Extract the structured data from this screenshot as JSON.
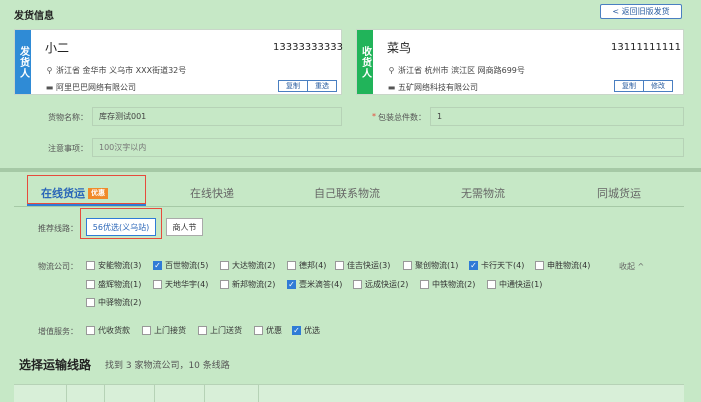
{
  "header": {
    "title": "发货信息",
    "back_label": "< 返回旧版发货"
  },
  "sender": {
    "tag": "发货人",
    "name": "小二",
    "phone": "13333333333",
    "address": "浙江省 金华市 义乌市 XXX街道32号",
    "company": "阿里巴巴网络有限公司",
    "btn_copy": "复制",
    "btn_reselect": "重选"
  },
  "receiver": {
    "tag": "收货人",
    "name": "菜鸟",
    "phone": "13111111111",
    "address": "浙江省 杭州市 滨江区 网商路699号",
    "company": "五矿网络科技有限公司",
    "btn_copy": "复制",
    "btn_edit": "修改"
  },
  "goods": {
    "name_label": "货物名称：",
    "name_value": "库存测试001",
    "pkg_label": "包装总件数：",
    "pkg_star": "*",
    "pkg_value": "1",
    "notes_label": "注意事项：",
    "notes_placeholder": "100汉字以内"
  },
  "tabs": [
    {
      "label": "在线货运",
      "badge": "优惠"
    },
    {
      "label": "在线快递"
    },
    {
      "label": "自己联系物流"
    },
    {
      "label": "无需物流"
    },
    {
      "label": "同城货运"
    }
  ],
  "routes": {
    "label": "推荐线路：",
    "selected": "56优选(义乌站)",
    "other": "商人节"
  },
  "logistics": {
    "label": "物流公司：",
    "collapse": "收起 ^",
    "row1": [
      {
        "text": "安能物流(3)",
        "checked": false
      },
      {
        "text": "百世物流(5)",
        "checked": true
      },
      {
        "text": "大达物流(2)",
        "checked": false
      },
      {
        "text": "德邦(4)",
        "checked": false
      },
      {
        "text": "佳吉快运(3)",
        "checked": false
      },
      {
        "text": "聚创物流(1)",
        "checked": false
      },
      {
        "text": "卡行天下(4)",
        "checked": true
      },
      {
        "text": "申胜物流(4)",
        "checked": false
      }
    ],
    "row2": [
      {
        "text": "盛辉物流(1)",
        "checked": false
      },
      {
        "text": "天地华宇(4)",
        "checked": false
      },
      {
        "text": "新邦物流(2)",
        "checked": false
      },
      {
        "text": "壹米滴答(4)",
        "checked": true
      },
      {
        "text": "远成快运(2)",
        "checked": false
      },
      {
        "text": "中铁物流(2)",
        "checked": false
      },
      {
        "text": "中通快运(1)",
        "checked": false
      }
    ],
    "row3": [
      {
        "text": "中驿物流(2)",
        "checked": false
      }
    ]
  },
  "services": {
    "label": "增值服务：",
    "items": [
      {
        "text": "代收货款",
        "checked": false
      },
      {
        "text": "上门接货",
        "checked": false
      },
      {
        "text": "上门送货",
        "checked": false
      },
      {
        "text": "优惠",
        "checked": false
      },
      {
        "text": "优选",
        "checked": true
      }
    ]
  },
  "route_section": {
    "title": "选择运输线路",
    "found": "找到 3 家物流公司，10 条线路"
  },
  "colors": {
    "accent": "#2f7bd6",
    "sender_tag": "#2f8bd6",
    "receiver_tag": "#21b45a",
    "highlight": "#e64b3c",
    "badge": "#f08a2a"
  }
}
